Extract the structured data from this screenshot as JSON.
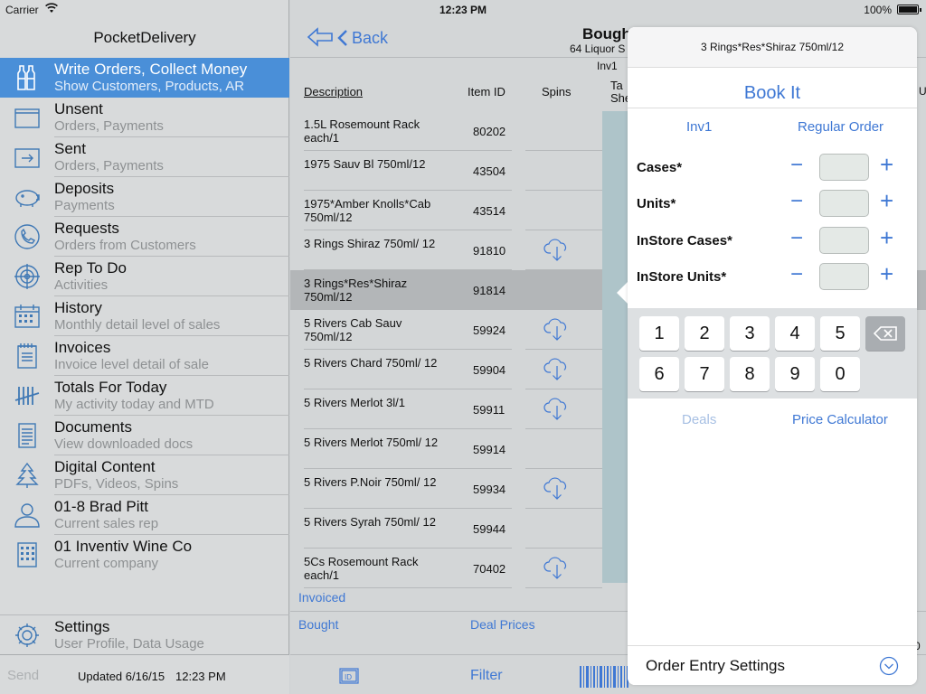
{
  "status": {
    "carrier": "Carrier",
    "time": "12:23 PM",
    "battery": "100%",
    "battery_level": 1.0
  },
  "sidebar": {
    "title": "PocketDelivery",
    "items": [
      {
        "title": "Write Orders, Collect Money",
        "subtitle": "Show Customers, Products, AR",
        "icon": "bottles-icon"
      },
      {
        "title": "Unsent",
        "subtitle": "Orders, Payments",
        "icon": "folder-icon"
      },
      {
        "title": "Sent",
        "subtitle": "Orders, Payments",
        "icon": "sent-box-icon"
      },
      {
        "title": "Deposits",
        "subtitle": "Payments",
        "icon": "piggy-bank-icon"
      },
      {
        "title": "Requests",
        "subtitle": "Orders from Customers",
        "icon": "phone-circle-icon"
      },
      {
        "title": "Rep To Do",
        "subtitle": "Activities",
        "icon": "target-icon"
      },
      {
        "title": "History",
        "subtitle": "Monthly detail level of sales",
        "icon": "calendar-icon"
      },
      {
        "title": "Invoices",
        "subtitle": "Invoice level detail of sale",
        "icon": "notepad-icon"
      },
      {
        "title": "Totals For Today",
        "subtitle": "My activity today and MTD",
        "icon": "tally-icon"
      },
      {
        "title": "Documents",
        "subtitle": "View downloaded docs",
        "icon": "document-icon"
      },
      {
        "title": "Digital Content",
        "subtitle": "PDFs, Videos, Spins",
        "icon": "tree-icon"
      },
      {
        "title": "01-8 Brad Pitt",
        "subtitle": "Current sales rep",
        "icon": "person-icon"
      },
      {
        "title": "01 Inventiv Wine Co",
        "subtitle": "Current company",
        "icon": "building-icon"
      }
    ],
    "settings": {
      "title": "Settings",
      "subtitle": "User Profile, Data Usage",
      "icon": "gear-icon"
    },
    "footer": {
      "send": "Send",
      "updated": "Updated 6/16/15",
      "updated_time": "12:23 PM"
    }
  },
  "main": {
    "back_label": "Back",
    "title": "Bought",
    "subtitle": "64 Liquor S",
    "inv_label": "Inv1",
    "columns": {
      "description": "Description",
      "item_id": "Item ID",
      "spins": "Spins",
      "t1": "Ta",
      "t2": "She"
    },
    "edge_u": "U",
    "edge_o": "0",
    "rows": [
      {
        "description": "1.5L Rosemount Rack each/1",
        "item_id": "80202",
        "cloud": false
      },
      {
        "description": "1975 Sauv Bl 750ml/12",
        "item_id": "43504",
        "cloud": false
      },
      {
        "description": "1975*Amber Knolls*Cab 750ml/12",
        "item_id": "43514",
        "cloud": false
      },
      {
        "description": "3 Rings Shiraz 750ml/ 12",
        "item_id": "91810",
        "cloud": true
      },
      {
        "description": "3 Rings*Res*Shiraz 750ml/12",
        "item_id": "91814",
        "cloud": false,
        "selected": true
      },
      {
        "description": "5 Rivers Cab Sauv 750ml/12",
        "item_id": "59924",
        "cloud": true
      },
      {
        "description": "5 Rivers Chard 750ml/ 12",
        "item_id": "59904",
        "cloud": true
      },
      {
        "description": "5 Rivers Merlot 3l/1",
        "item_id": "59911",
        "cloud": true
      },
      {
        "description": "5 Rivers Merlot 750ml/ 12",
        "item_id": "59914",
        "cloud": false
      },
      {
        "description": "5 Rivers P.Noir 750ml/ 12",
        "item_id": "59934",
        "cloud": true
      },
      {
        "description": "5 Rivers Syrah 750ml/ 12",
        "item_id": "59944",
        "cloud": false
      },
      {
        "description": "5Cs Rosemount Rack each/1",
        "item_id": "70402",
        "cloud": true
      }
    ],
    "invoiced": "Invoiced",
    "bought": "Bought",
    "deal_prices": "Deal Prices",
    "filter": "Filter"
  },
  "popover": {
    "product": "3 Rings*Res*Shiraz 750ml/12",
    "book_it": "Book It",
    "inv": "Inv1",
    "order_type": "Regular Order",
    "fields": [
      {
        "label": "Cases*",
        "value": ""
      },
      {
        "label": "Units*",
        "value": ""
      },
      {
        "label": "InStore Cases*",
        "value": ""
      },
      {
        "label": "InStore Units*",
        "value": ""
      }
    ],
    "keys_row1": [
      "1",
      "2",
      "3",
      "4",
      "5"
    ],
    "keys_row2": [
      "6",
      "7",
      "8",
      "9",
      "0"
    ],
    "deals": "Deals",
    "price_calculator": "Price Calculator",
    "footer": "Order Entry Settings"
  },
  "colors": {
    "accent": "#3f78d4",
    "sidebar_active": "#4a8fd8",
    "teal_strip": "#aec4c9"
  }
}
